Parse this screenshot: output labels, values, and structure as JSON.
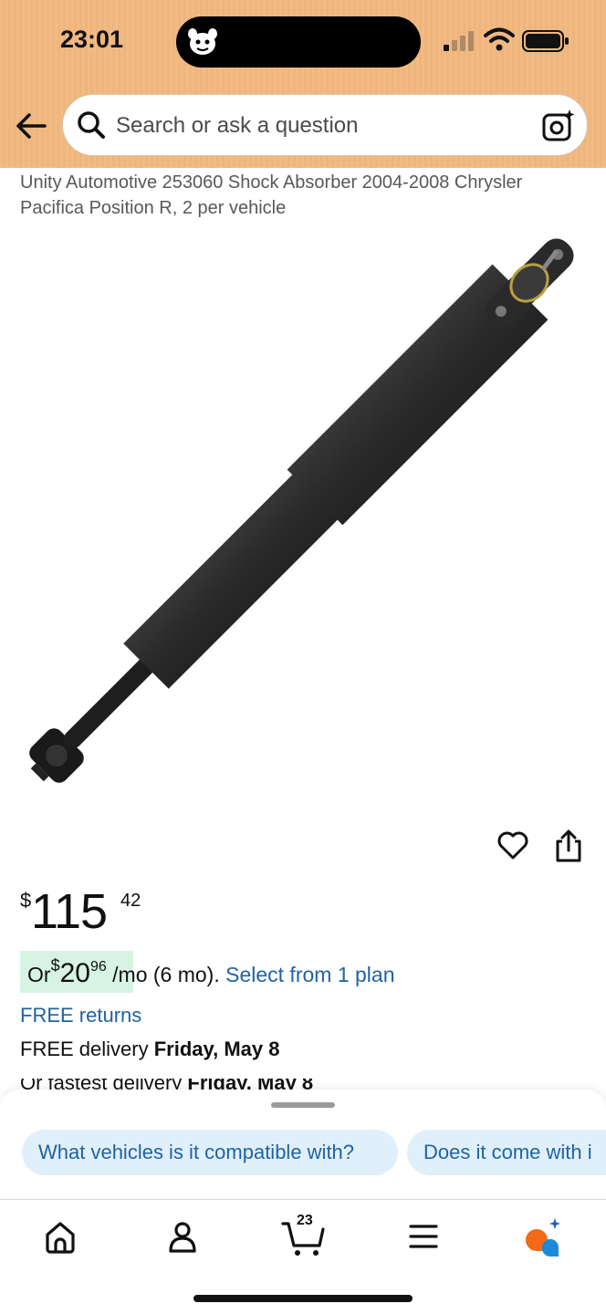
{
  "status_bar": {
    "time": "23:01"
  },
  "header": {
    "search_placeholder": "Search or ask a question",
    "icons": [
      "back-arrow-icon",
      "search-icon",
      "camera-search-icon"
    ]
  },
  "product": {
    "title": "Unity Automotive 253060 Shock Absorber 2004-2008 Chrysler Pacifica Position R, 2 per vehicle",
    "price": {
      "symbol": "$",
      "whole": "115",
      "fraction": "42"
    },
    "installment": {
      "prefix": "Or ",
      "symbol": "$",
      "whole": "20",
      "fraction": "96",
      "suffix": "/mo (6 mo).",
      "link": "Select from 1 plan"
    },
    "free_returns": "FREE returns",
    "delivery": {
      "prefix": "FREE delivery ",
      "date": "Friday, May 8"
    },
    "fastest_delivery": {
      "prefix": "Or fastest delivery ",
      "date": "Friday, May 8"
    }
  },
  "suggestions": [
    "What vehicles is it compatible with?",
    "Does it come with i"
  ],
  "bottom_nav": {
    "cart_count": "23",
    "items": [
      "home-icon",
      "account-icon",
      "cart-icon",
      "menu-icon",
      "rufus-icon"
    ]
  },
  "colors": {
    "header_bg": "#f1bb83",
    "link": "#2162a1",
    "installment_bg": "#d7f3e3",
    "chip_bg": "#e0f0fb"
  }
}
